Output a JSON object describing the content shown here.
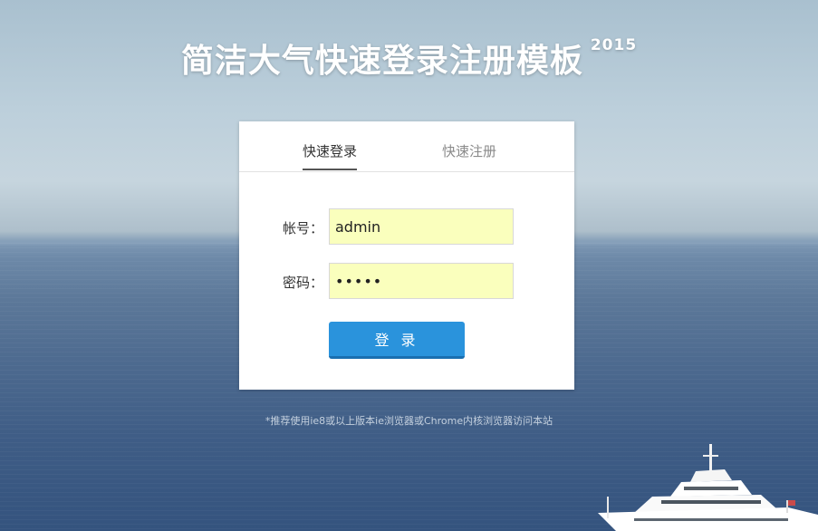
{
  "page": {
    "title": "简洁大气快速登录注册模板",
    "title_year": "2015"
  },
  "tabs": {
    "login": "快速登录",
    "register": "快速注册",
    "active": "login"
  },
  "form": {
    "username_label": "帐号：",
    "username_value": "admin",
    "password_label": "密码：",
    "password_value": "•••••",
    "submit_label": "登 录"
  },
  "footnote": "*推荐使用ie8或以上版本ie浏览器或Chrome内核浏览器访问本站",
  "colors": {
    "button": "#2a93dc",
    "input_autofill": "#faffbd"
  }
}
